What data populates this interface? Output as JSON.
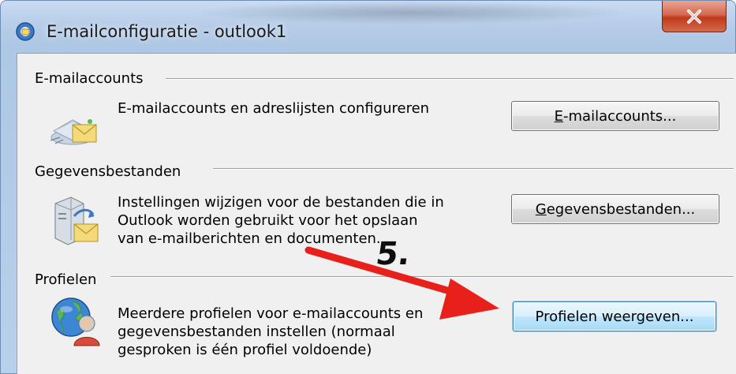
{
  "window": {
    "title": "E-mailconfiguratie - outlook1",
    "app_icon": "outlook-mail-icon",
    "close_icon": "close-icon"
  },
  "sections": {
    "email": {
      "heading": "E-mailaccounts",
      "icon": "email-accounts-icon",
      "description": [
        "E-mailaccounts en adreslijsten configureren"
      ],
      "button_label_accel": "E",
      "button_label_rest": "-mailaccounts..."
    },
    "data": {
      "heading": "Gegevensbestanden",
      "icon": "data-files-icon",
      "description": [
        "Instellingen wijzigen voor de bestanden die in",
        "Outlook worden gebruikt voor het opslaan",
        "van e-mailberichten en documenten."
      ],
      "button_label_accel": "G",
      "button_label_rest": "egevensbestanden..."
    },
    "profiles": {
      "heading": "Profielen",
      "icon": "profiles-globe-icon",
      "description": [
        "Meerdere profielen voor e-mailaccounts en",
        "gegevensbestanden instellen (normaal",
        "gesproken is één profiel voldoende)"
      ],
      "button_label_accel": "",
      "button_label_rest": "Profielen weergeven..."
    }
  },
  "annotation": {
    "step": "5.",
    "arrow_color": "#e8201c"
  }
}
